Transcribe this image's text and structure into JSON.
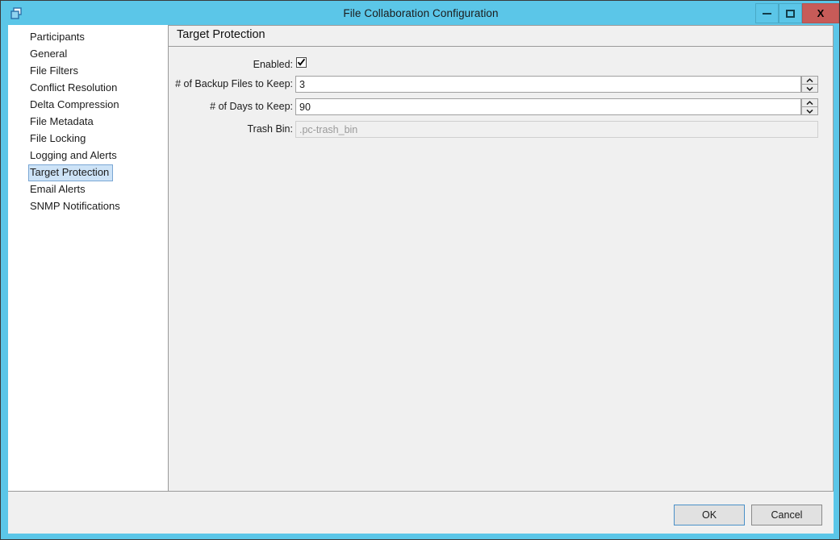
{
  "window": {
    "title": "File Collaboration Configuration",
    "app_icon": "windows-cascade-icon",
    "controls": {
      "minimize": "minimize-icon",
      "maximize": "maximize-icon",
      "close": "X"
    },
    "titlebar_color": "#5bc6e8",
    "close_color": "#c75b58"
  },
  "sidebar": {
    "items": [
      {
        "label": "Participants",
        "selected": false
      },
      {
        "label": "General",
        "selected": false
      },
      {
        "label": "File Filters",
        "selected": false
      },
      {
        "label": "Conflict Resolution",
        "selected": false
      },
      {
        "label": "Delta Compression",
        "selected": false
      },
      {
        "label": "File Metadata",
        "selected": false
      },
      {
        "label": "File Locking",
        "selected": false
      },
      {
        "label": "Logging and Alerts",
        "selected": false
      },
      {
        "label": "Target Protection",
        "selected": true
      },
      {
        "label": "Email Alerts",
        "selected": false
      },
      {
        "label": "SNMP Notifications",
        "selected": false
      }
    ],
    "selected_bg": "#cde3f7",
    "selected_border": "#7aa7d4"
  },
  "content": {
    "title": "Target Protection",
    "fields": {
      "enabled": {
        "label": "Enabled:",
        "checked": true
      },
      "backup_files": {
        "label": "# of Backup Files to Keep:",
        "value": "3"
      },
      "days_to_keep": {
        "label": "# of Days to Keep:",
        "value": "90"
      },
      "trash_bin": {
        "label": "Trash Bin:",
        "value": ".pc-trash_bin",
        "disabled": true
      }
    }
  },
  "footer": {
    "ok_label": "OK",
    "cancel_label": "Cancel"
  }
}
